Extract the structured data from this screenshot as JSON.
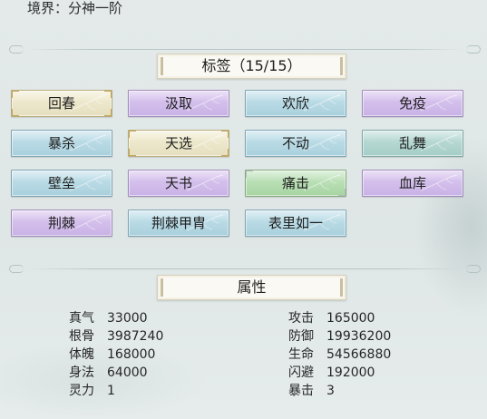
{
  "realm": {
    "text": "境界：分神一阶"
  },
  "tags_section": {
    "title": "标签（15/15）"
  },
  "tags": [
    {
      "label": "回春",
      "color": "#ece6c8",
      "style": "cream-gold"
    },
    {
      "label": "汲取",
      "color": "#d3bdec",
      "style": "purple"
    },
    {
      "label": "欢欣",
      "color": "#b9dae5",
      "style": "blue"
    },
    {
      "label": "免疫",
      "color": "#d3bdec",
      "style": "purple"
    },
    {
      "label": "暴杀",
      "color": "#b9dae5",
      "style": "blue"
    },
    {
      "label": "天选",
      "color": "#ece6c8",
      "style": "cream-gold"
    },
    {
      "label": "不动",
      "color": "#b9dae5",
      "style": "blue"
    },
    {
      "label": "乱舞",
      "color": "#b5d7d2",
      "style": "teal"
    },
    {
      "label": "壁垒",
      "color": "#b9dae5",
      "style": "blue"
    },
    {
      "label": "天书",
      "color": "#d3bdec",
      "style": "purple"
    },
    {
      "label": "痛击",
      "color": "#b8ddb3",
      "style": "green-grey"
    },
    {
      "label": "血库",
      "color": "#d3bdec",
      "style": "purple"
    },
    {
      "label": "荆棘",
      "color": "#d3bdec",
      "style": "purple"
    },
    {
      "label": "荆棘甲胄",
      "color": "#b9dae5",
      "style": "blue"
    },
    {
      "label": "表里如一",
      "color": "#b9dae5",
      "style": "blue"
    }
  ],
  "attributes_section": {
    "title": "属性"
  },
  "attributes_left": [
    {
      "key": "真气",
      "value": "33000"
    },
    {
      "key": "根骨",
      "value": "3987240"
    },
    {
      "key": "体魄",
      "value": "168000"
    },
    {
      "key": "身法",
      "value": "64000"
    },
    {
      "key": "灵力",
      "value": "1"
    }
  ],
  "attributes_right": [
    {
      "key": "攻击",
      "value": "165000"
    },
    {
      "key": "防御",
      "value": "19936200"
    },
    {
      "key": "生命",
      "value": "54566880"
    },
    {
      "key": "闪避",
      "value": "192000"
    },
    {
      "key": "暴击",
      "value": "3"
    }
  ]
}
